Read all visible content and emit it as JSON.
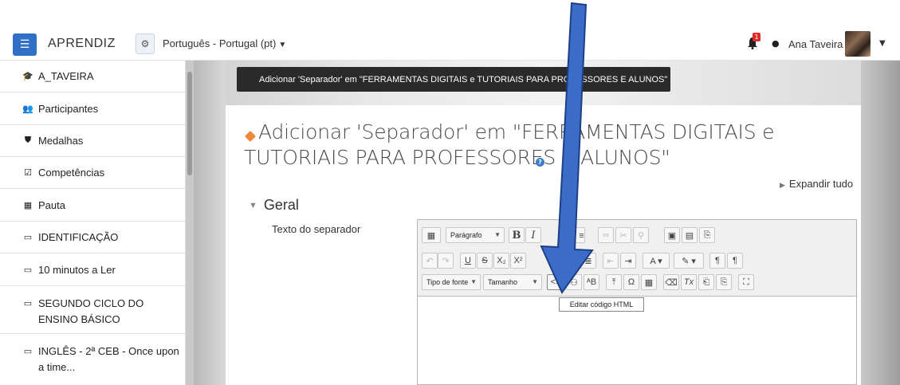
{
  "navbar": {
    "menu_icon": "hamburger-icon",
    "brand": "APRENDIZ",
    "language": "Português - Portugal (pt)",
    "notification_count": "1",
    "user_name": "Ana Taveira"
  },
  "header": {
    "tooltip": "Adicionar 'Separador' em \"FERRAMENTAS DIGITAIS e TUTORIAIS PARA PROFESSORES E ALUNOS\""
  },
  "sidebar": {
    "items": [
      {
        "label": "A_TAVEIRA",
        "icon": "graduation-cap-icon"
      },
      {
        "label": "Participantes",
        "icon": "users-icon"
      },
      {
        "label": "Medalhas",
        "icon": "shield-icon"
      },
      {
        "label": "Competências",
        "icon": "checkbox-icon"
      },
      {
        "label": "Pauta",
        "icon": "table-icon"
      },
      {
        "label": "IDENTIFICAÇÃO",
        "icon": "folder-icon"
      },
      {
        "label": "10 minutos a Ler",
        "icon": "folder-icon"
      },
      {
        "label": "SEGUNDO CICLO DO ENSINO BÁSICO",
        "icon": "folder-icon"
      },
      {
        "label": "INGLÊS - 2ª CEB - Once upon a time...",
        "icon": "folder-icon"
      }
    ]
  },
  "main": {
    "title": "Adicionar 'Separador' em \"FERRAMENTAS DIGITAIS e TUTORIAIS PARA PROFESSORES E ALUNOS\"",
    "expand_all": "Expandir tudo",
    "section": "Geral",
    "field_label": "Texto do separador"
  },
  "editor": {
    "paragraph_select": "Parágrafo",
    "font_select": "Tipo de fonte",
    "size_select": "Tamanho",
    "html_tooltip": "Editar código HTML"
  },
  "colors": {
    "menu_button": "#2f6fc6",
    "arrow": "#3b6cc8",
    "tag": "#f0883a",
    "badge": "#e02b2b"
  }
}
